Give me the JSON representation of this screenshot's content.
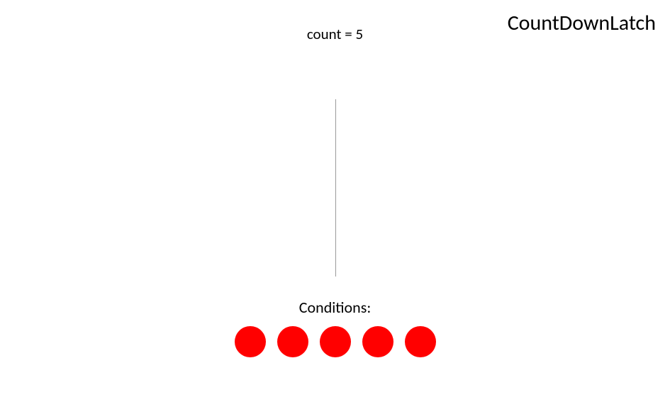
{
  "title": "CountDownLatch",
  "count_label": "count = 5",
  "conditions_label": "Conditions:",
  "conditions_count": 5,
  "dot_color": "#ff0000"
}
